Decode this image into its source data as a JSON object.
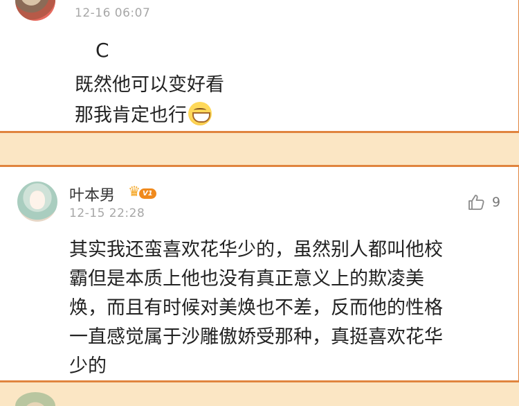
{
  "comments": [
    {
      "timestamp": "12-16 06:07",
      "lines": [
        "C",
        "既然他可以变好看",
        "那我肯定也行"
      ],
      "emoji": "grinning-face-emoji"
    },
    {
      "username": "叶本男",
      "badge": "V1",
      "timestamp": "12-15 22:28",
      "likes": "9",
      "lines": [
        "其实我还蛮喜欢花华少的，虽然别人都叫他校",
        "霸但是本质上他也没有真正意义上的欺凌美",
        "焕，而且有时候对美焕也不差，反而他的性格",
        "一直感觉属于沙雕傲娇受那种，真挺喜欢花华",
        "少的"
      ]
    }
  ],
  "colors": {
    "card_border": "#e0843e",
    "page_background": "#fbe6c4",
    "timestamp": "#a7a7a7",
    "vip_badge": "#f08a1d"
  },
  "icons": [
    "thumbs-up-icon",
    "vip-crown-icon"
  ]
}
